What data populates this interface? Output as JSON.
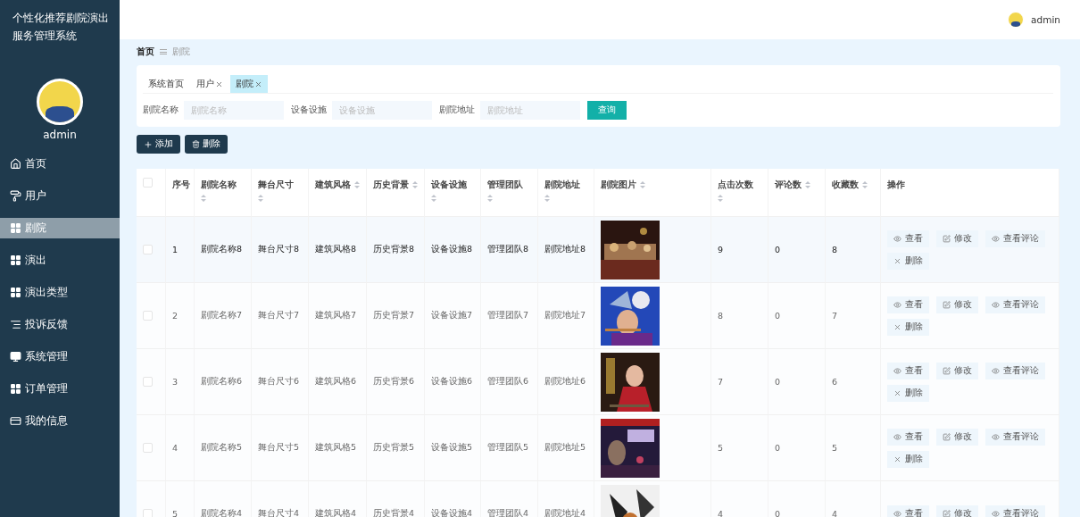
{
  "app_title": "个性化推荐剧院演出服务管理系统",
  "header": {
    "user": "admin"
  },
  "sidebar": {
    "user": "admin",
    "items": [
      {
        "label": "首页",
        "kind": "home",
        "selected": false
      },
      {
        "label": "用户",
        "kind": "pin",
        "selected": false
      },
      {
        "label": "剧院",
        "kind": "grid",
        "selected": true
      },
      {
        "label": "演出",
        "kind": "grid",
        "selected": false
      },
      {
        "label": "演出类型",
        "kind": "grid",
        "selected": false
      },
      {
        "label": "投诉反馈",
        "kind": "list",
        "selected": false
      },
      {
        "label": "系统管理",
        "kind": "monitor",
        "selected": false
      },
      {
        "label": "订单管理",
        "kind": "grid",
        "selected": false
      },
      {
        "label": "我的信息",
        "kind": "card",
        "selected": false
      }
    ]
  },
  "breadcrumb": [
    "首页",
    "剧院"
  ],
  "tabs": [
    {
      "label": "系统首页",
      "closable": false,
      "selected": false
    },
    {
      "label": "用户",
      "closable": true,
      "selected": false
    },
    {
      "label": "剧院",
      "closable": true,
      "selected": true
    }
  ],
  "search": {
    "fields": [
      {
        "label": "剧院名称",
        "placeholder": "剧院名称"
      },
      {
        "label": "设备设施",
        "placeholder": "设备设施"
      },
      {
        "label": "剧院地址",
        "placeholder": "剧院地址"
      }
    ],
    "button": "查询"
  },
  "toolbar": [
    {
      "kind": "add",
      "label": "添加"
    },
    {
      "kind": "delete",
      "label": "删除"
    }
  ],
  "table": {
    "select_all_checked": false,
    "columns": [
      {
        "label": "序号",
        "sortable": false
      },
      {
        "label": "剧院名称",
        "sortable": true
      },
      {
        "label": "舞台尺寸",
        "sortable": true
      },
      {
        "label": "建筑风格",
        "sortable": true
      },
      {
        "label": "历史背景",
        "sortable": true
      },
      {
        "label": "设备设施",
        "sortable": true
      },
      {
        "label": "管理团队",
        "sortable": true
      },
      {
        "label": "剧院地址",
        "sortable": true
      },
      {
        "label": "剧院图片",
        "sortable": true
      },
      {
        "label": "点击次数",
        "sortable": true
      },
      {
        "label": "评论数",
        "sortable": true
      },
      {
        "label": "收藏数",
        "sortable": true
      },
      {
        "label": "操作",
        "sortable": false
      }
    ],
    "rows": [
      {
        "checked": false,
        "hovered": true,
        "cells": [
          "1",
          "剧院名称8",
          "舞台尺寸8",
          "建筑风格8",
          "历史背景8",
          "设备设施8",
          "管理团队8",
          "剧院地址8"
        ],
        "picture": {
          "kind": "picture"
        },
        "stats": [
          "9",
          "0",
          "8"
        ],
        "actions": [
          {
            "kind": "view",
            "label": "查看"
          },
          {
            "kind": "edit",
            "label": "修改"
          },
          {
            "kind": "view",
            "label": "查看评论"
          },
          {
            "kind": "delete",
            "label": "删除"
          }
        ]
      },
      {
        "checked": false,
        "hovered": false,
        "cells": [
          "2",
          "剧院名称7",
          "舞台尺寸7",
          "建筑风格7",
          "历史背景7",
          "设备设施7",
          "管理团队7",
          "剧院地址7"
        ],
        "picture": {
          "kind": "picture"
        },
        "stats": [
          "8",
          "0",
          "7"
        ],
        "actions": [
          {
            "kind": "view",
            "label": "查看"
          },
          {
            "kind": "edit",
            "label": "修改"
          },
          {
            "kind": "view",
            "label": "查看评论"
          },
          {
            "kind": "delete",
            "label": "删除"
          }
        ]
      },
      {
        "checked": false,
        "hovered": false,
        "cells": [
          "3",
          "剧院名称6",
          "舞台尺寸6",
          "建筑风格6",
          "历史背景6",
          "设备设施6",
          "管理团队6",
          "剧院地址6"
        ],
        "picture": {
          "kind": "picture"
        },
        "stats": [
          "7",
          "0",
          "6"
        ],
        "actions": [
          {
            "kind": "view",
            "label": "查看"
          },
          {
            "kind": "edit",
            "label": "修改"
          },
          {
            "kind": "view",
            "label": "查看评论"
          },
          {
            "kind": "delete",
            "label": "删除"
          }
        ]
      },
      {
        "checked": false,
        "hovered": false,
        "cells": [
          "4",
          "剧院名称5",
          "舞台尺寸5",
          "建筑风格5",
          "历史背景5",
          "设备设施5",
          "管理团队5",
          "剧院地址5"
        ],
        "picture": {
          "kind": "picture"
        },
        "stats": [
          "5",
          "0",
          "5"
        ],
        "actions": [
          {
            "kind": "view",
            "label": "查看"
          },
          {
            "kind": "edit",
            "label": "修改"
          },
          {
            "kind": "view",
            "label": "查看评论"
          },
          {
            "kind": "delete",
            "label": "删除"
          }
        ]
      },
      {
        "checked": false,
        "hovered": false,
        "cells": [
          "5",
          "剧院名称4",
          "舞台尺寸4",
          "建筑风格4",
          "历史背景4",
          "设备设施4",
          "管理团队4",
          "剧院地址4"
        ],
        "picture": {
          "kind": "picture"
        },
        "stats": [
          "4",
          "0",
          "4"
        ],
        "actions": [
          {
            "kind": "view",
            "label": "查看"
          },
          {
            "kind": "edit",
            "label": "修改"
          },
          {
            "kind": "view",
            "label": "查看评论"
          }
        ]
      }
    ]
  }
}
